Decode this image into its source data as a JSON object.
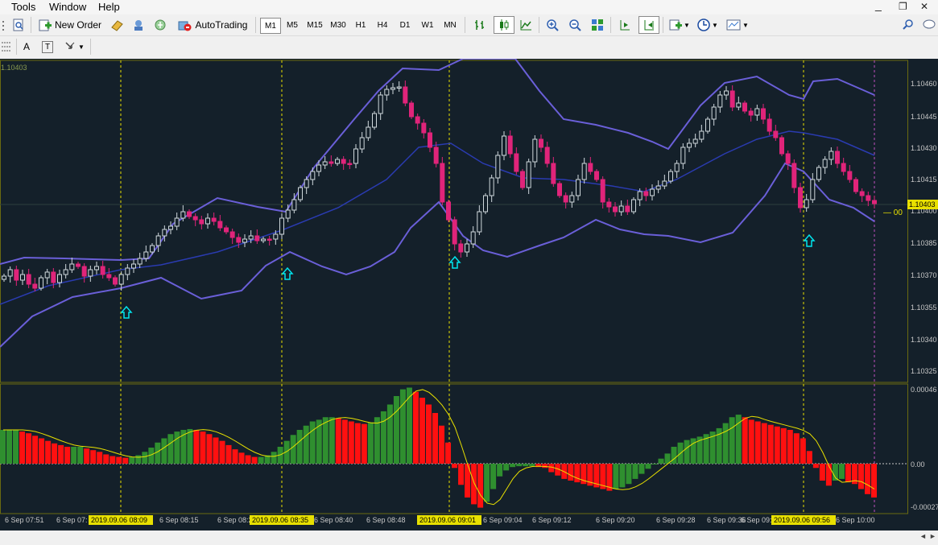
{
  "menu": {
    "tools": "Tools",
    "window": "Window",
    "help": "Help"
  },
  "window_controls": {
    "minimize": "_",
    "restore": "❐",
    "close": "✕"
  },
  "toolbar": {
    "new_order": "New Order",
    "autotrading": "AutoTrading",
    "timeframes": [
      "M1",
      "M5",
      "M15",
      "M30",
      "H1",
      "H4",
      "D1",
      "W1",
      "MN"
    ],
    "active_timeframe": "M1",
    "text_tool": "A",
    "label_tool": "T"
  },
  "chart": {
    "corner_price": "1.10403",
    "price_ticks": [
      "1.10460",
      "1.10445",
      "1.10430",
      "1.10415",
      "1.10400",
      "1.10385",
      "1.10370",
      "1.10355",
      "1.10340",
      "1.10325"
    ],
    "current_price": "1.10403",
    "current_price_marker": "— 00",
    "indicator_ticks": [
      "0.00046",
      "0.00",
      "-0.00027"
    ],
    "time_ticks": [
      "6 Sep 07:51",
      "6 Sep 07:",
      "6 Sep 08:15",
      "6 Sep 08:24",
      "6 Sep 08:40",
      "6 Sep 08:48",
      "6 Sep 09:04",
      "6 Sep 09:12",
      "6 Sep 09:20",
      "6 Sep 09:28",
      "6 Sep 09:36",
      "6 Sep 09:44",
      "6 Sep 10:00"
    ],
    "highlighted_times": [
      "2019.09.06 08:09",
      "2019.09.06 08:35",
      "2019.09.06 09:01",
      "2019.09.06 09:56"
    ],
    "colors": {
      "background": "#14202a",
      "bull_candle": "#cfd8dc",
      "bear_candle": "#e0247a",
      "bollinger": "#6a5fd8",
      "middle_band": "#2a3bb0",
      "histogram_up": "#2f8f2f",
      "histogram_down": "#ff1010",
      "signal_line": "#e8e000",
      "arrow": "#00e5ee",
      "grid_marker": "#e8e000"
    }
  }
}
